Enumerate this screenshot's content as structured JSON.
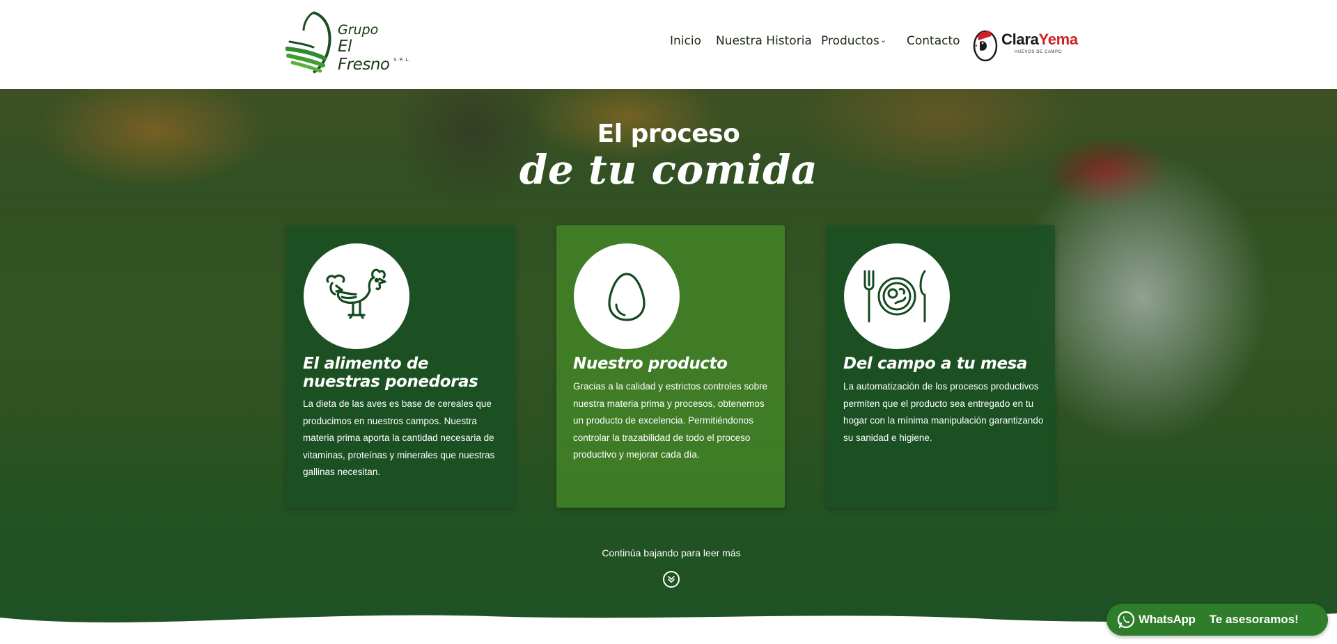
{
  "header": {
    "logo": {
      "line1": "Grupo",
      "line2": "El Fresno",
      "suffix": "S.R.L."
    },
    "nav": {
      "inicio": "Inicio",
      "historia": "Nuestra Historia",
      "productos": "Productos",
      "contacto": "Contacto"
    },
    "partner_logo": {
      "clara": "Clara",
      "yema": "Yema",
      "sub": "HUEVOS DE CAMPO"
    }
  },
  "hero": {
    "title_small": "El proceso",
    "title_big": "de tu comida"
  },
  "cards": [
    {
      "icon": "rooster-icon",
      "title": "El alimento de nuestras ponedoras",
      "text": "La dieta de las aves es base de cereales que producimos en nuestros campos. Nuestra materia prima aporta la cantidad necesaria de vitaminas, proteínas y minerales que nuestras gallinas necesitan."
    },
    {
      "icon": "egg-icon",
      "title": "Nuestro producto",
      "text": "Gracias a la calidad y estrictos controles sobre nuestra materia prima y procesos, obtenemos un producto de excelencia. Permitiéndonos controlar la trazabilidad de todo el proceso productivo y mejorar cada día."
    },
    {
      "icon": "plate-cutlery-icon",
      "title": "Del campo a tu mesa",
      "text": "La automatización de los procesos productivos permiten que el producto sea entregado en tu hogar con la mínima manipulación garantizando su sanidad e higiene."
    }
  ],
  "scroll": {
    "text": "Continúa bajando para leer más",
    "icon": "double-chevron-down-icon"
  },
  "whatsapp": {
    "brand": "WhatsApp",
    "cta": "Te asesoramos!",
    "icon": "whatsapp-icon"
  },
  "colors": {
    "brand_green": "#1b4d22",
    "card_dark": "#19502a",
    "card_light": "#468c28",
    "whatsapp": "#2f7d2b",
    "yema_red": "#d0202a"
  }
}
